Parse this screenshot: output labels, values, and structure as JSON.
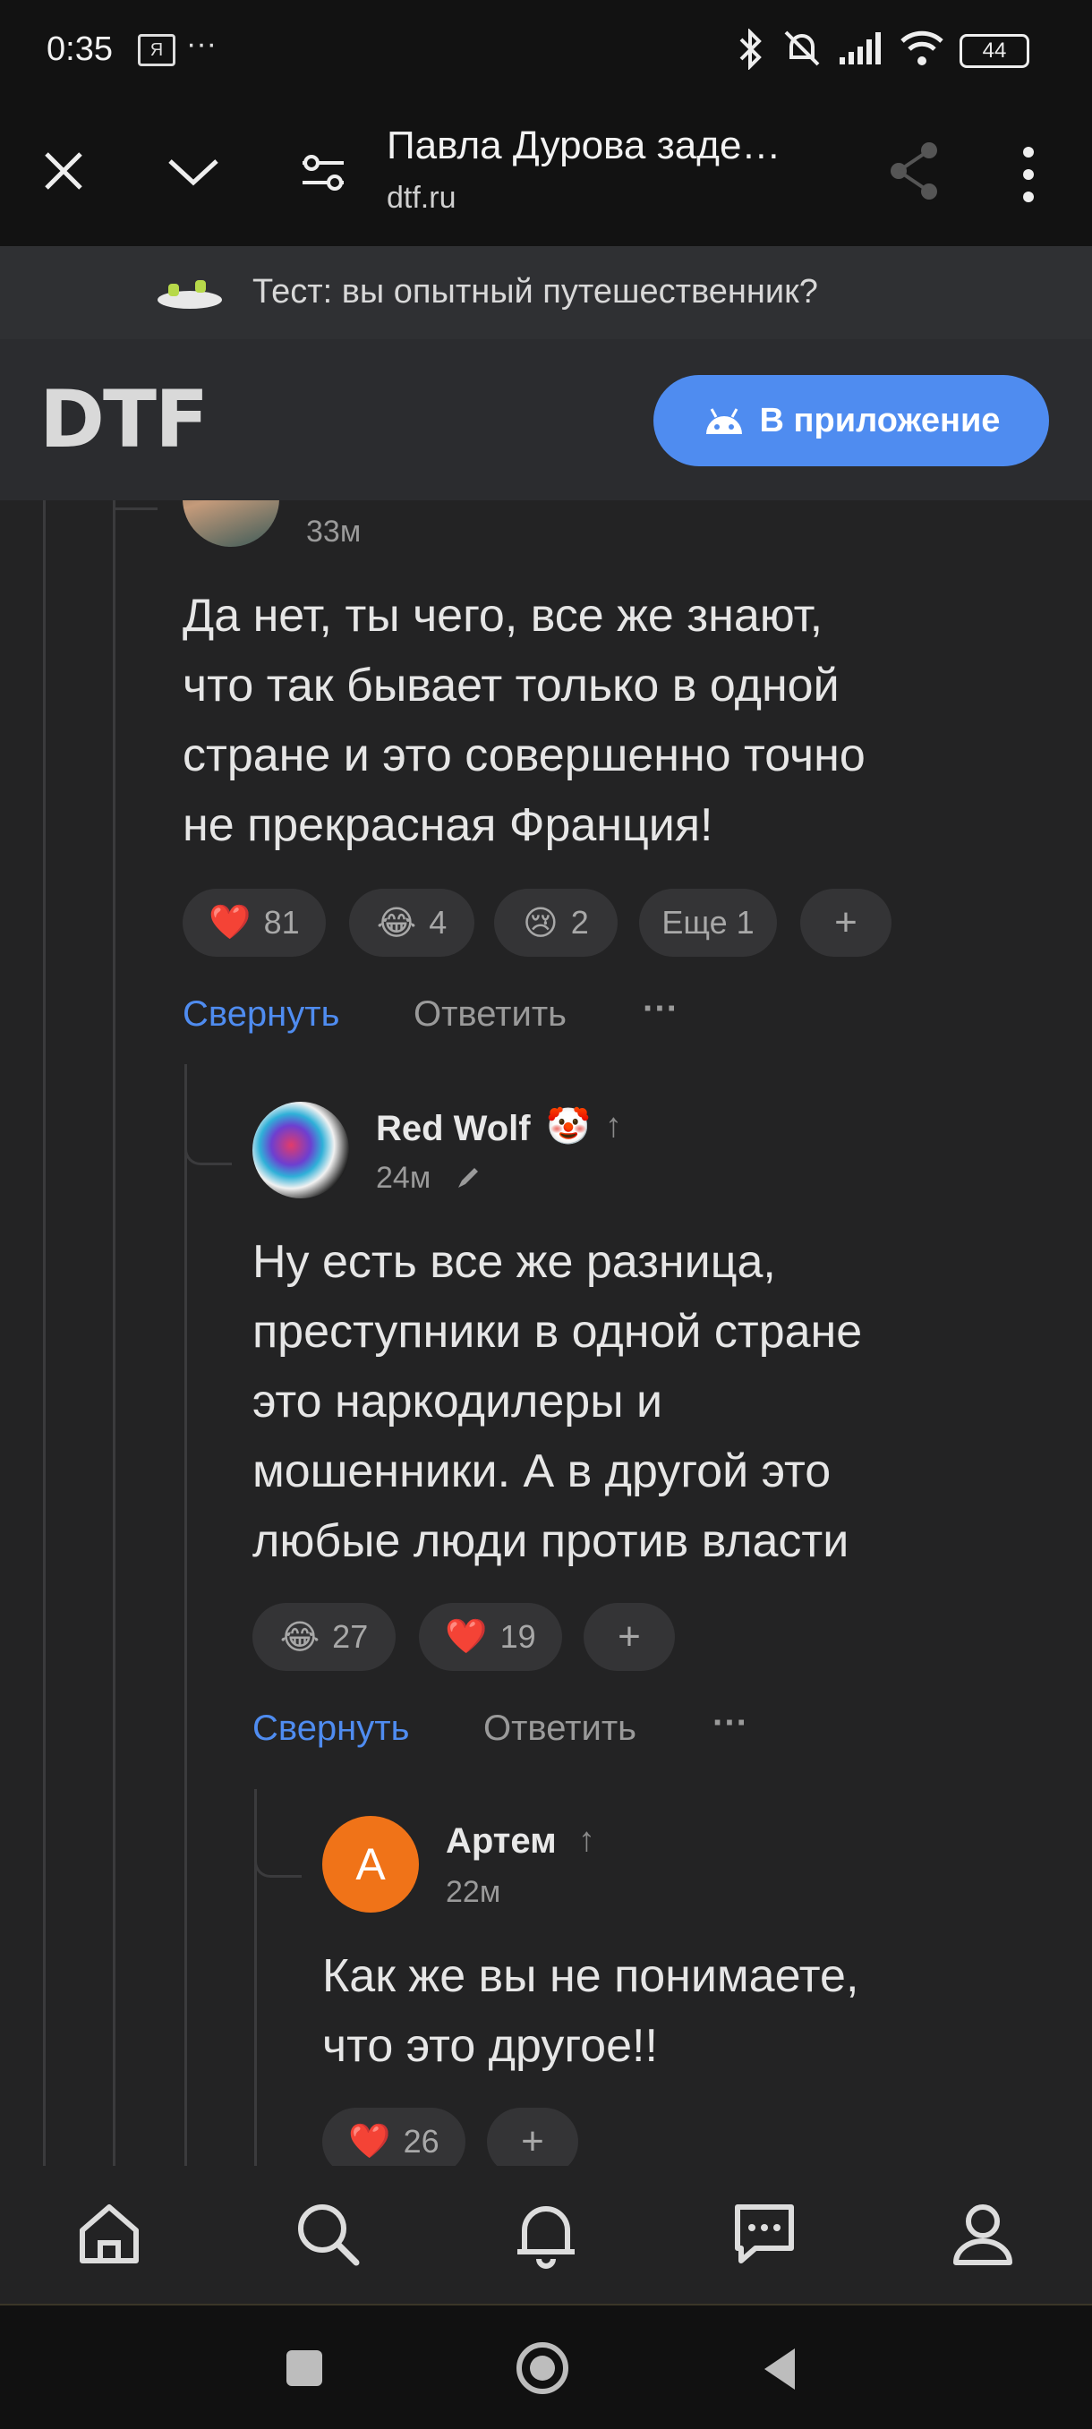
{
  "status": {
    "time": "0:35",
    "ya_badge": "Я",
    "more": "···",
    "battery": "44"
  },
  "browser": {
    "title": "Павла Дурова заде…",
    "url": "dtf.ru"
  },
  "promo": {
    "text": "Тест: вы опытный путешественник?"
  },
  "header": {
    "logo": "DTF",
    "app_button": "В приложение"
  },
  "comments": [
    {
      "time": "33м",
      "text_lines": [
        "Да нет, ты чего, все же знают,",
        "что так бывает только в одной",
        "стране и это совершенно точно",
        "не прекрасная Франция!"
      ],
      "reactions": [
        {
          "emoji": "❤️",
          "count": "81"
        },
        {
          "emoji": "😂",
          "count": "4"
        },
        {
          "emoji": "😢",
          "count": "2"
        }
      ],
      "more_reactions": "Еще 1",
      "add": "+",
      "collapse": "Свернуть",
      "reply": "Ответить",
      "dots": "···"
    },
    {
      "author": "Red Wolf",
      "author_emoji": "🤡",
      "arrow": "↑",
      "time": "24м",
      "text_lines": [
        "Ну есть все же разница,",
        "преступники в одной стране",
        "это наркодилеры и",
        "мошенники. А в другой это",
        "любые люди против власти"
      ],
      "reactions": [
        {
          "emoji": "😂",
          "count": "27"
        },
        {
          "emoji": "❤️",
          "count": "19"
        }
      ],
      "add": "+",
      "collapse": "Свернуть",
      "reply": "Ответить",
      "dots": "···"
    },
    {
      "author": "Артем",
      "avatar_letter": "А",
      "arrow": "↑",
      "time": "22м",
      "text_lines": [
        "Как же вы не понимаете,",
        "что это другое!!"
      ],
      "reactions": [
        {
          "emoji": "❤️",
          "count": "26"
        }
      ],
      "add": "+"
    }
  ],
  "colors": {
    "accent": "#4f8cf0",
    "orange_avatar": "#f07318",
    "background": "#232324"
  }
}
